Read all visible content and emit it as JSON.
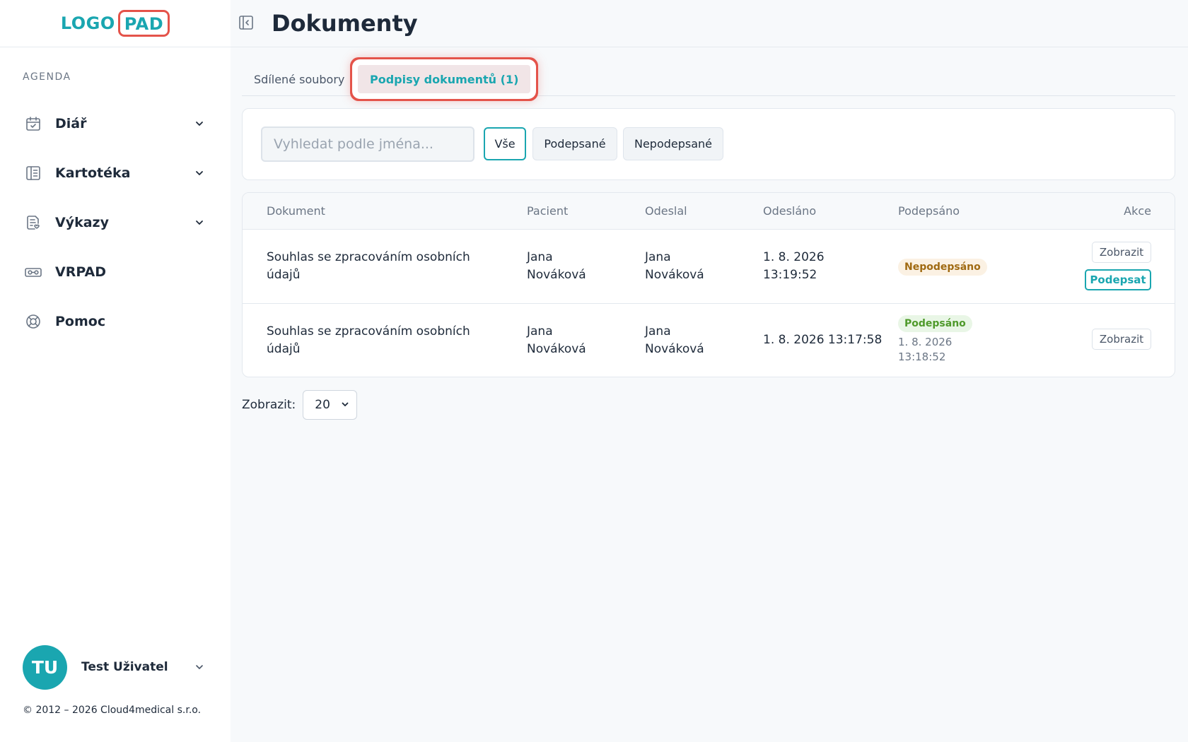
{
  "logo": {
    "part1": "LOGO",
    "part2": "PAD"
  },
  "sidebar": {
    "section_title": "AGENDA",
    "items": [
      {
        "label": "Diář",
        "icon": "calendar-icon",
        "has_chevron": true
      },
      {
        "label": "Kartotéka",
        "icon": "book-icon",
        "has_chevron": true
      },
      {
        "label": "Výkazy",
        "icon": "report-icon",
        "has_chevron": true
      },
      {
        "label": "VRPAD",
        "icon": "vr-headset-icon",
        "has_chevron": false
      },
      {
        "label": "Pomoc",
        "icon": "lifebuoy-icon",
        "has_chevron": false
      }
    ],
    "user": {
      "initials": "TU",
      "name": "Test Uživatel"
    },
    "copyright": "© 2012 – 2026 Cloud4medical s.r.o."
  },
  "header": {
    "title": "Dokumenty"
  },
  "tabs": [
    {
      "label": "Sdílené soubory",
      "active": false
    },
    {
      "label": "Podpisy dokumentů (1)",
      "active": true
    }
  ],
  "filters": {
    "search_placeholder": "Vyhledat podle jména...",
    "search_value": "",
    "buttons": [
      {
        "label": "Vše",
        "active": true
      },
      {
        "label": "Podepsané",
        "active": false
      },
      {
        "label": "Nepodepsané",
        "active": false
      }
    ]
  },
  "table": {
    "columns": [
      "Dokument",
      "Pacient",
      "Odeslal",
      "Odesláno",
      "Podepsáno",
      "Akce"
    ],
    "rows": [
      {
        "document": "Souhlas se zpracováním osobních údajů",
        "patient": "Jana Nováková",
        "sender": "Jana Nováková",
        "sent": "1. 8. 2026 13:19:52",
        "status": "Nepodepsáno",
        "signed_at": "",
        "actions": [
          "Zobrazit",
          "Podepsat"
        ]
      },
      {
        "document": "Souhlas se zpracováním osobních údajů",
        "patient": "Jana Nováková",
        "sender": "Jana Nováková",
        "sent": "1. 8. 2026 13:17:58",
        "status": "Podepsáno",
        "signed_at": "1. 8. 2026 13:18:52",
        "actions": [
          "Zobrazit"
        ]
      }
    ]
  },
  "pager": {
    "label": "Zobrazit:",
    "page_size": "20"
  },
  "colors": {
    "accent": "#1aa6b0",
    "highlight": "#e4534a",
    "warn": "#a06a12",
    "ok": "#4f9a2b"
  }
}
